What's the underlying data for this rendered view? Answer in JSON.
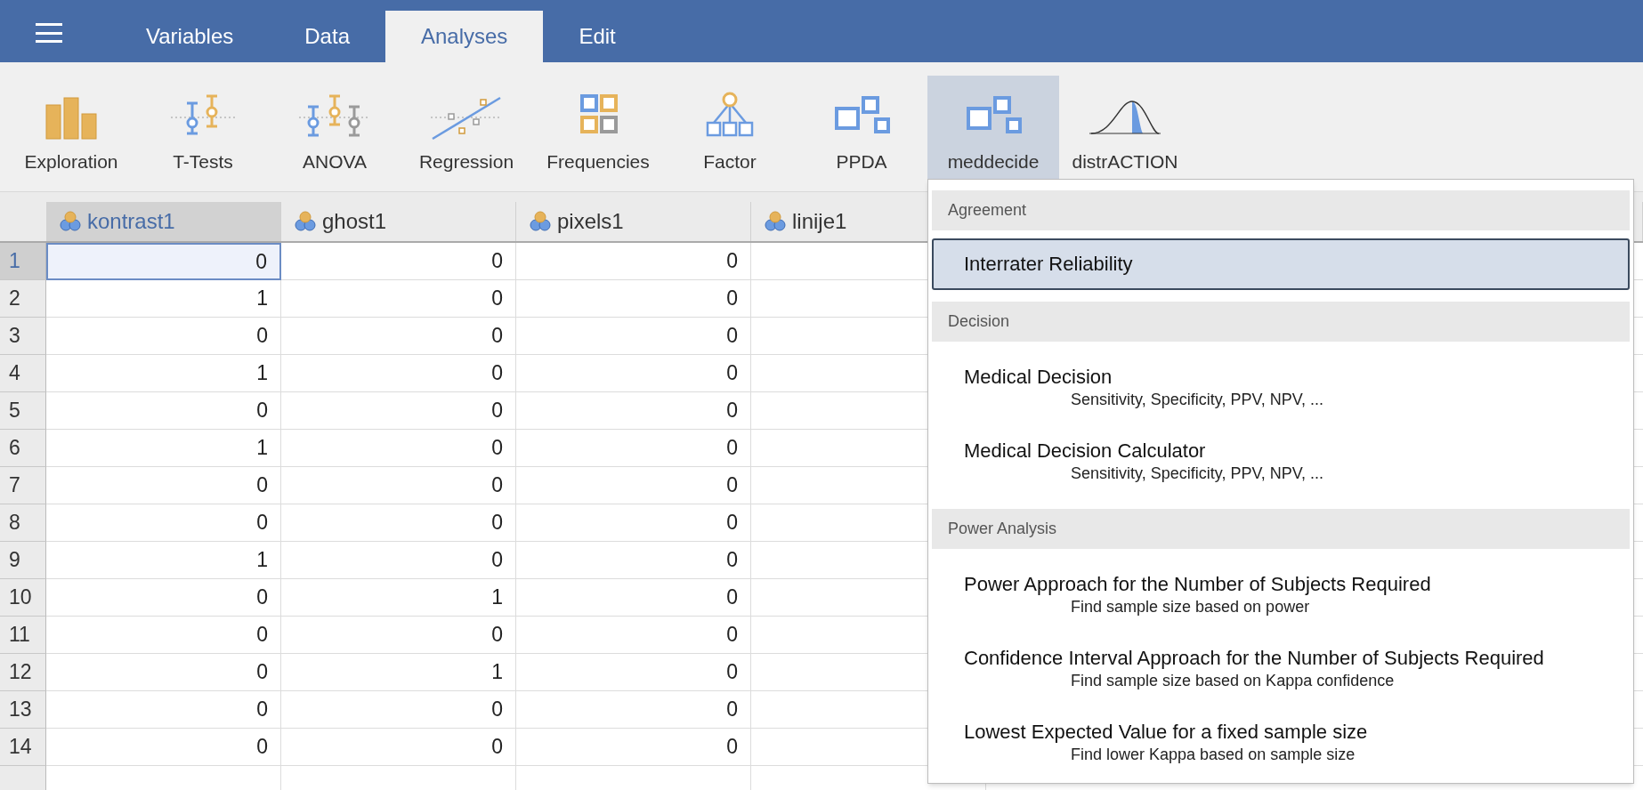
{
  "tabs": [
    {
      "label": "Variables",
      "selected": false
    },
    {
      "label": "Data",
      "selected": false
    },
    {
      "label": "Analyses",
      "selected": true
    },
    {
      "label": "Edit",
      "selected": false
    }
  ],
  "toolbar": [
    {
      "label": "Exploration",
      "selected": false
    },
    {
      "label": "T-Tests",
      "selected": false
    },
    {
      "label": "ANOVA",
      "selected": false
    },
    {
      "label": "Regression",
      "selected": false
    },
    {
      "label": "Frequencies",
      "selected": false
    },
    {
      "label": "Factor",
      "selected": false
    },
    {
      "label": "PPDA",
      "selected": false
    },
    {
      "label": "meddecide",
      "selected": true
    },
    {
      "label": "distrACTION",
      "selected": false
    }
  ],
  "table": {
    "columns": [
      {
        "name": "kontrast1",
        "selected": true
      },
      {
        "name": "ghost1",
        "selected": false
      },
      {
        "name": "pixels1",
        "selected": false
      },
      {
        "name": "linije1",
        "selected": false
      }
    ],
    "rows": [
      {
        "number": "1",
        "selected": true,
        "cells": [
          "0",
          "0",
          "0"
        ]
      },
      {
        "number": "2",
        "selected": false,
        "cells": [
          "1",
          "0",
          "0"
        ]
      },
      {
        "number": "3",
        "selected": false,
        "cells": [
          "0",
          "0",
          "0"
        ]
      },
      {
        "number": "4",
        "selected": false,
        "cells": [
          "1",
          "0",
          "0"
        ]
      },
      {
        "number": "5",
        "selected": false,
        "cells": [
          "0",
          "0",
          "0"
        ]
      },
      {
        "number": "6",
        "selected": false,
        "cells": [
          "1",
          "0",
          "0"
        ]
      },
      {
        "number": "7",
        "selected": false,
        "cells": [
          "0",
          "0",
          "0"
        ]
      },
      {
        "number": "8",
        "selected": false,
        "cells": [
          "0",
          "0",
          "0"
        ]
      },
      {
        "number": "9",
        "selected": false,
        "cells": [
          "1",
          "0",
          "0"
        ]
      },
      {
        "number": "10",
        "selected": false,
        "cells": [
          "0",
          "1",
          "0"
        ]
      },
      {
        "number": "11",
        "selected": false,
        "cells": [
          "0",
          "0",
          "0"
        ]
      },
      {
        "number": "12",
        "selected": false,
        "cells": [
          "0",
          "1",
          "0"
        ]
      },
      {
        "number": "13",
        "selected": false,
        "cells": [
          "0",
          "0",
          "0"
        ]
      },
      {
        "number": "14",
        "selected": false,
        "cells": [
          "0",
          "0",
          "0"
        ]
      }
    ]
  },
  "menu": {
    "sections": [
      {
        "title": "Agreement",
        "items": [
          {
            "title": "Interrater Reliability",
            "selected": true
          }
        ]
      },
      {
        "title": "Decision",
        "items": [
          {
            "title": "Medical Decision",
            "subtitle": "Sensitivity, Specificity, PPV, NPV, ...",
            "selected": false
          },
          {
            "title": "Medical Decision Calculator",
            "subtitle": "Sensitivity, Specificity, PPV, NPV, ...",
            "selected": false
          }
        ]
      },
      {
        "title": "Power Analysis",
        "items": [
          {
            "title": "Power Approach for the Number of Subjects Required",
            "subtitle": "Find sample size based on power",
            "selected": false
          },
          {
            "title": "Confidence Interval Approach for the Number of Subjects Required",
            "subtitle": "Find sample size based on Kappa confidence",
            "selected": false
          },
          {
            "title": "Lowest Expected Value for a fixed sample size",
            "subtitle": "Find lower Kappa based on sample size",
            "selected": false
          }
        ]
      }
    ]
  }
}
